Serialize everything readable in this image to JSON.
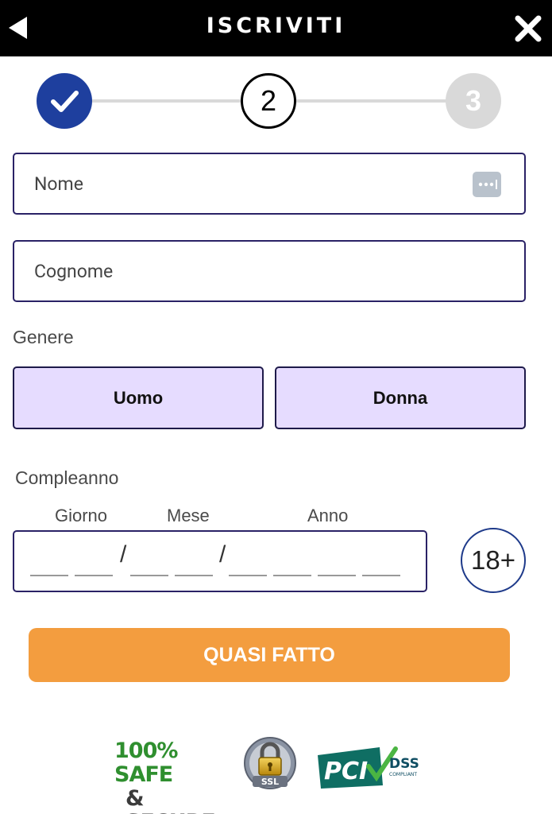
{
  "header": {
    "title": "ISCRIVITI",
    "back_icon": "back-arrow-icon",
    "close_icon": "close-icon"
  },
  "stepper": {
    "steps": [
      {
        "label": "",
        "state": "completed",
        "icon": "check-icon"
      },
      {
        "label": "2",
        "state": "current"
      },
      {
        "label": "3",
        "state": "upcoming"
      }
    ],
    "colors": {
      "completed": "#1e3f9e",
      "upcoming": "#d9d9d9"
    }
  },
  "form": {
    "first_name": {
      "value": "",
      "placeholder": "Nome"
    },
    "last_name": {
      "value": "",
      "placeholder": "Cognome"
    },
    "gender": {
      "label": "Genere",
      "options": [
        "Uomo",
        "Donna"
      ]
    },
    "birthday": {
      "label": "Compleanno",
      "day_label": "Giorno",
      "month_label": "Mese",
      "year_label": "Anno",
      "separator": "/",
      "day": "",
      "month": "",
      "year": ""
    },
    "age_badge": "18+",
    "submit_label": "QUASI FATTO",
    "submit_color": "#f39d3f"
  },
  "trust_badges": {
    "safe_line1": "100% SAFE",
    "safe_line2": "& SECURE",
    "ssl_text": "SSL",
    "pci_text": "PCI",
    "dss_text": "DSS",
    "dss_sub": "COMPLIANT"
  }
}
